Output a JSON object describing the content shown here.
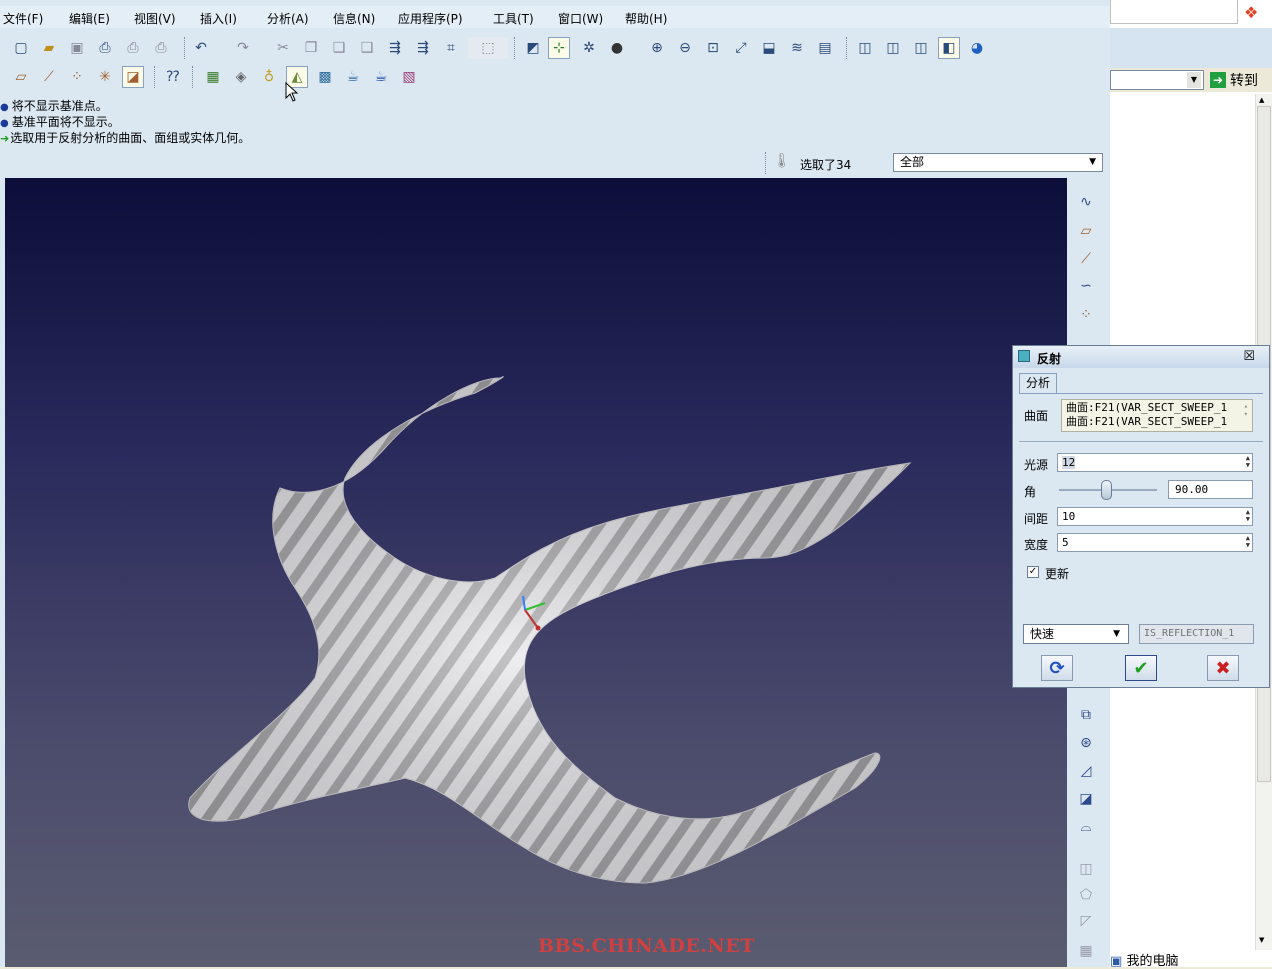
{
  "menu": [
    "文件(F)",
    "编辑(E)",
    "视图(V)",
    "插入(I)",
    "分析(A)",
    "信息(N)",
    "应用程序(P)",
    "工具(T)",
    "窗口(W)",
    "帮助(H)"
  ],
  "messages": [
    "将不显示基准点。",
    "基准平面将不显示。",
    "选取用于反射分析的曲面、面组或实体几何。"
  ],
  "status": {
    "selected": "选取了34",
    "filter": "全部"
  },
  "watermark": "BBS.CHINADE.NET",
  "ext": {
    "go_label": "转到",
    "my_computer": "我的电脑"
  },
  "dialog": {
    "title": "反射",
    "tab": "分析",
    "surface_label": "曲面",
    "surface_items": [
      "曲面:F21(VAR_SECT_SWEEP_1",
      "曲面:F21(VAR_SECT_SWEEP_1"
    ],
    "light_label": "光源",
    "light_value": "12",
    "angle_label": "角",
    "angle_value": "90.00",
    "spacing_label": "间距",
    "spacing_value": "10",
    "width_label": "宽度",
    "width_value": "5",
    "update_label": "更新",
    "update_checked": true,
    "mode_value": "快速",
    "name_value": "IS_REFLECTION_1"
  },
  "colors": {
    "accent_green": "#20a020",
    "cancel_red": "#cc2020",
    "watermark": "#d04040"
  }
}
